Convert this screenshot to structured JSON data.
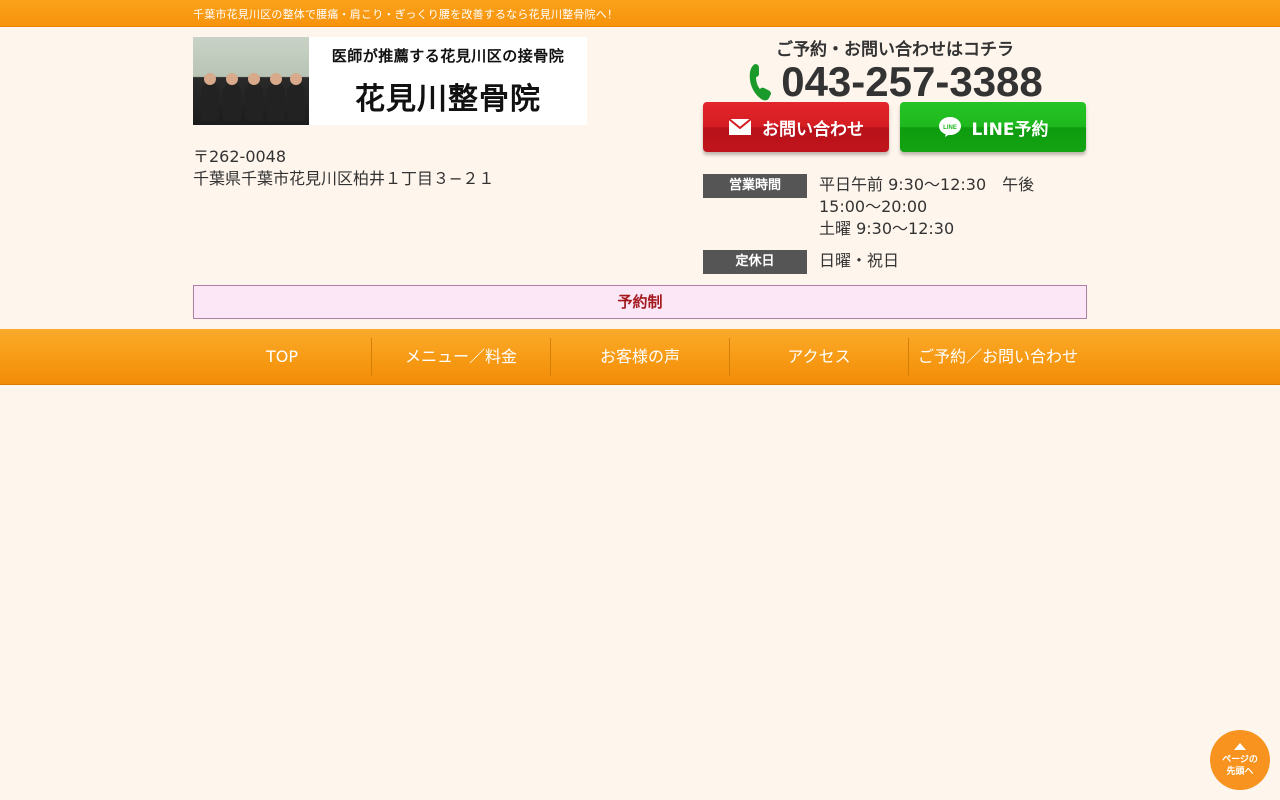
{
  "topbar": {
    "tagline": "千葉市花見川区の整体で腰痛・肩こり・ぎっくり腰を改善するなら花見川整骨院へ！"
  },
  "logo": {
    "sub": "医師が推薦する花見川区の接骨院",
    "name": "花見川整骨院"
  },
  "address": {
    "postal": "〒262-0048",
    "street": "千葉県千葉市花見川区柏井１丁目３−２１"
  },
  "contact": {
    "caption": "ご予約・お問い合わせはコチラ",
    "phone": "043-257-3388",
    "mail_button": "お問い合わせ",
    "line_button": "LINE予約"
  },
  "hours": {
    "label": "営業時間",
    "value": "平日午前 9:30〜12:30　午後\n15:00〜20:00\n土曜 9:30〜12:30",
    "closed_label": "定休日",
    "closed_value": "日曜・祝日"
  },
  "notice": "予約制",
  "nav": [
    "TOP",
    "メニュー／料金",
    "お客様の声",
    "アクセス",
    "ご予約／お問い合わせ"
  ],
  "back_to_top": {
    "line1": "ページの",
    "line2": "先頭へ"
  },
  "colors": {
    "orange": "#f7931e",
    "background": "#fef5ec",
    "mail_red": "#d41d22",
    "line_green": "#1db81d"
  }
}
